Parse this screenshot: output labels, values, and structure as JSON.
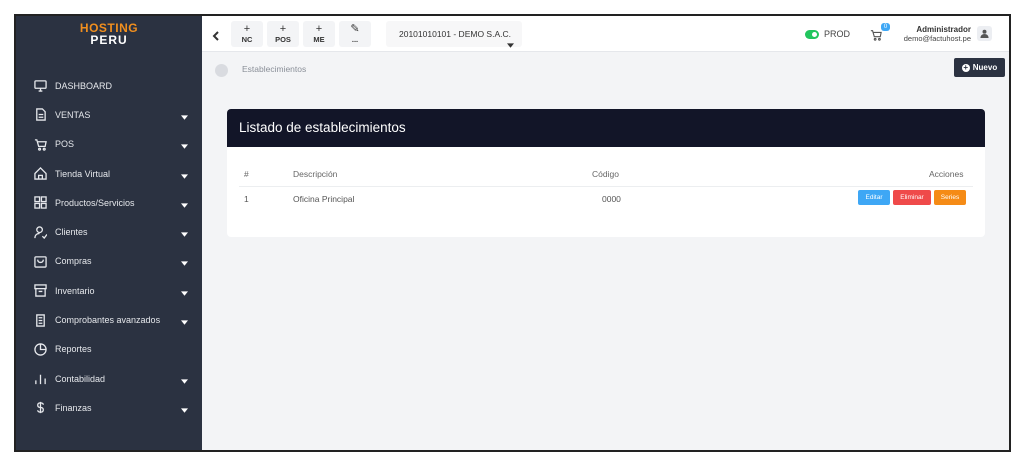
{
  "logo": {
    "line1": "HOSTING",
    "line2": "PERU"
  },
  "sidebar": {
    "items": [
      {
        "label": "DASHBOARD",
        "icon": "monitor-icon",
        "expandable": false
      },
      {
        "label": "VENTAS",
        "icon": "document-icon",
        "expandable": true
      },
      {
        "label": "POS",
        "icon": "cart-icon",
        "expandable": true
      },
      {
        "label": "Tienda Virtual",
        "icon": "home-icon",
        "expandable": true
      },
      {
        "label": "Productos/Servicios",
        "icon": "grid-icon",
        "expandable": true
      },
      {
        "label": "Clientes",
        "icon": "user-check-icon",
        "expandable": true
      },
      {
        "label": "Compras",
        "icon": "bag-icon",
        "expandable": true
      },
      {
        "label": "Inventario",
        "icon": "archive-icon",
        "expandable": true
      },
      {
        "label": "Comprobantes avanzados",
        "icon": "receipt-icon",
        "expandable": true
      },
      {
        "label": "Reportes",
        "icon": "pie-chart-icon",
        "expandable": false
      },
      {
        "label": "Contabilidad",
        "icon": "bar-chart-icon",
        "expandable": true
      },
      {
        "label": "Finanzas",
        "icon": "dollar-icon",
        "expandable": true
      }
    ]
  },
  "topbar": {
    "quick": [
      {
        "symbol": "+",
        "label": "NC"
      },
      {
        "symbol": "+",
        "label": "POS"
      },
      {
        "symbol": "+",
        "label": "ME"
      },
      {
        "symbol": "✎",
        "label": "..."
      }
    ],
    "company": "20101010101 - DEMO S.A.C.",
    "env": "PROD",
    "cart_count": "0",
    "user_name": "Administrador",
    "user_email": "demo@factuhost.pe"
  },
  "breadcrumb": {
    "label": "Establecimientos"
  },
  "actions": {
    "new_label": "Nuevo"
  },
  "card": {
    "title": "Listado de establecimientos",
    "columns": [
      "#",
      "Descripción",
      "Código",
      "Acciones"
    ],
    "rows": [
      {
        "num": "1",
        "descripcion": "Oficina Principal",
        "codigo": "0000"
      }
    ],
    "buttons": {
      "edit": "Editar",
      "delete": "Eliminar",
      "series": "Series"
    }
  },
  "colors": {
    "sidebar": "#2b3241",
    "card_header": "#121528",
    "edit": "#3ea7f5",
    "delete": "#ef4a4a",
    "series": "#f58b16",
    "toggle": "#22c55e"
  }
}
